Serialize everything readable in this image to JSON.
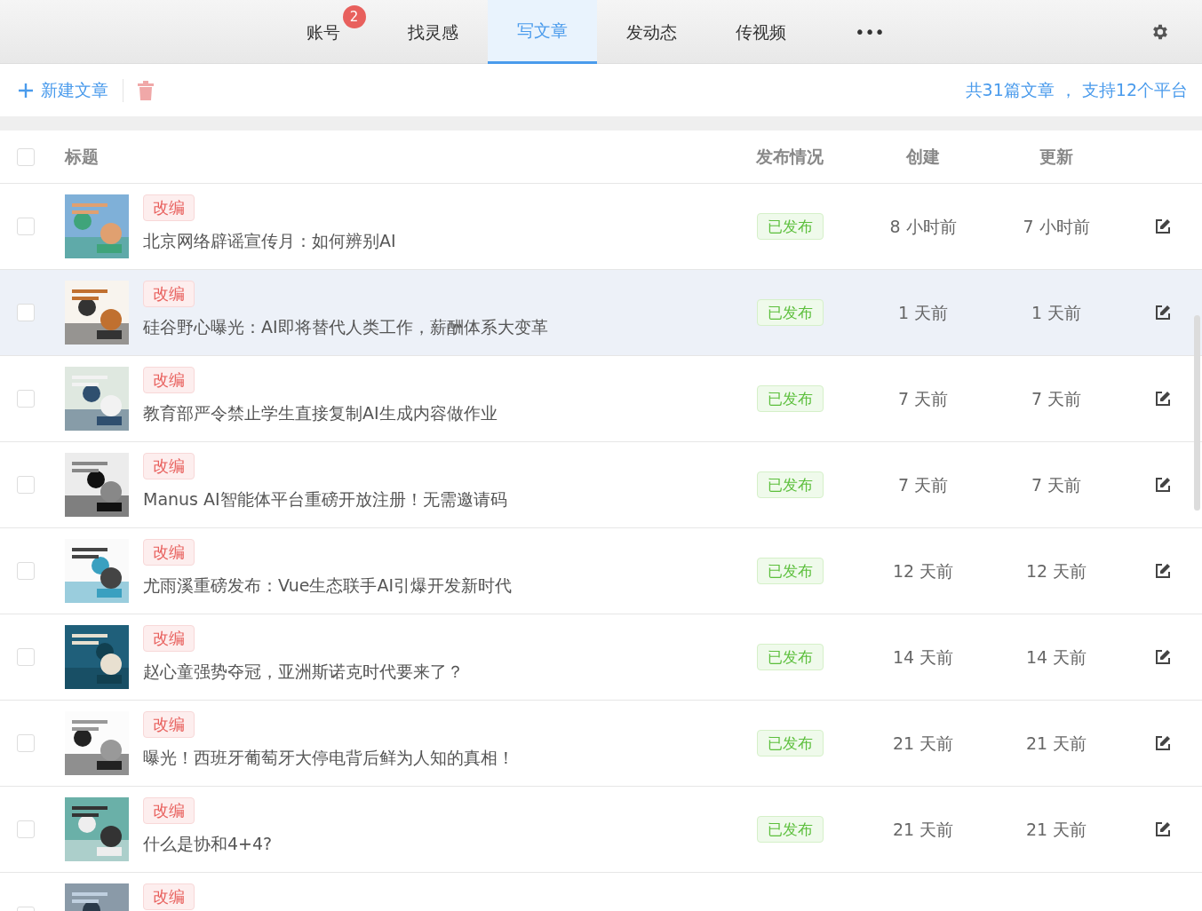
{
  "tabs": [
    {
      "label": "账号",
      "selected": false,
      "badge": "2"
    },
    {
      "label": "找灵感",
      "selected": false
    },
    {
      "label": "写文章",
      "selected": true
    },
    {
      "label": "发动态",
      "selected": false
    },
    {
      "label": "传视频",
      "selected": false
    },
    {
      "label": "•••",
      "selected": false
    }
  ],
  "toolbar": {
    "new_button": "新建文章",
    "summary": "共31篇文章 ， 支持12个平台"
  },
  "table": {
    "select_all_checked": false,
    "columns": [
      "标题",
      "发布情况",
      "创建",
      "更新"
    ],
    "rows": [
      {
        "checked": false,
        "highlighted": false,
        "tag": "改编",
        "title": "北京网络辟谣宣传月：如何辨别AI",
        "status": "已发布",
        "created": "8 小时前",
        "updated": "7 小时前"
      },
      {
        "checked": false,
        "highlighted": true,
        "tag": "改编",
        "title": "硅谷野心曝光：AI即将替代人类工作，薪酬体系大变革",
        "status": "已发布",
        "created": "1 天前",
        "updated": "1 天前"
      },
      {
        "checked": false,
        "highlighted": false,
        "tag": "改编",
        "title": "教育部严令禁止学生直接复制AI生成内容做作业",
        "status": "已发布",
        "created": "7 天前",
        "updated": "7 天前"
      },
      {
        "checked": false,
        "highlighted": false,
        "tag": "改编",
        "title": "Manus AI智能体平台重磅开放注册！无需邀请码",
        "status": "已发布",
        "created": "7 天前",
        "updated": "7 天前"
      },
      {
        "checked": false,
        "highlighted": false,
        "tag": "改编",
        "title": "尤雨溪重磅发布：Vue生态联手AI引爆开发新时代",
        "status": "已发布",
        "created": "12 天前",
        "updated": "12 天前"
      },
      {
        "checked": false,
        "highlighted": false,
        "tag": "改编",
        "title": "赵心童强势夺冠，亚洲斯诺克时代要来了？",
        "status": "已发布",
        "created": "14 天前",
        "updated": "14 天前"
      },
      {
        "checked": false,
        "highlighted": false,
        "tag": "改编",
        "title": "曝光！西班牙葡萄牙大停电背后鲜为人知的真相！",
        "status": "已发布",
        "created": "21 天前",
        "updated": "21 天前"
      },
      {
        "checked": false,
        "highlighted": false,
        "tag": "改编",
        "title": "什么是协和4+4?",
        "status": "已发布",
        "created": "21 天前",
        "updated": "21 天前"
      },
      {
        "checked": false,
        "highlighted": false,
        "tag": "改编"
      }
    ]
  }
}
